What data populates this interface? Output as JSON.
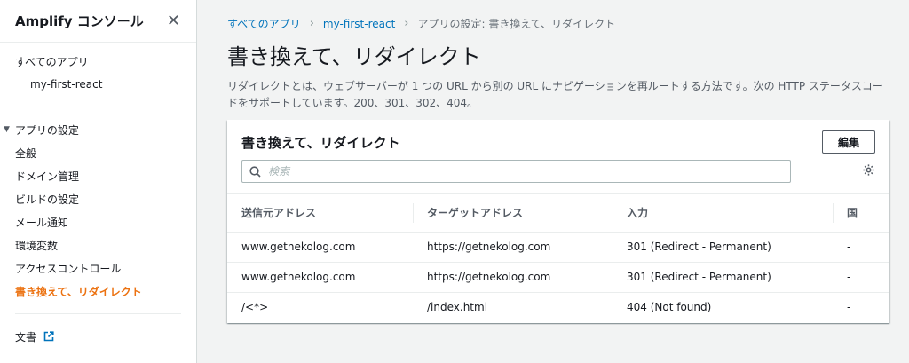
{
  "sidebar": {
    "title": "Amplify コンソール",
    "close_symbol": "✕",
    "all_apps": "すべてのアプリ",
    "app_name": "my-first-react",
    "group_label": "アプリの設定",
    "items": [
      {
        "label": "全般"
      },
      {
        "label": "ドメイン管理"
      },
      {
        "label": "ビルドの設定"
      },
      {
        "label": "メール通知"
      },
      {
        "label": "環境変数"
      },
      {
        "label": "アクセスコントロール"
      },
      {
        "label": "書き換えて、リダイレクト"
      }
    ],
    "docs_label": "文書"
  },
  "breadcrumb": {
    "items": [
      "すべてのアプリ",
      "my-first-react"
    ],
    "current": "アプリの設定: 書き換えて、リダイレクト"
  },
  "page": {
    "title": "書き換えて、リダイレクト",
    "description": "リダイレクトとは、ウェブサーバーが 1 つの URL から別の URL にナビゲーションを再ルートする方法です。次の HTTP ステータスコードをサポートしています。200、301、302、404。"
  },
  "panel": {
    "title": "書き換えて、リダイレクト",
    "edit_label": "編集",
    "search_placeholder": "検索",
    "columns": [
      "送信元アドレス",
      "ターゲットアドレス",
      "入力",
      "国"
    ],
    "rows": [
      [
        "www.getnekolog.com",
        "https://getnekolog.com",
        "301 (Redirect - Permanent)",
        "-"
      ],
      [
        "www.getnekolog.com",
        "https://getnekolog.com",
        "301 (Redirect - Permanent)",
        "-"
      ],
      [
        "/<*>",
        "/index.html",
        "404 (Not found)",
        "-"
      ]
    ]
  },
  "colors": {
    "accent": "#ec7211",
    "link": "#0073bb"
  }
}
